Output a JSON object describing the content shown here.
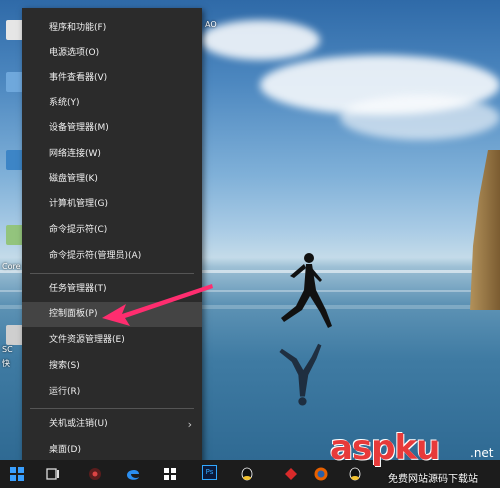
{
  "power_menu": {
    "items": [
      {
        "label": "程序和功能(F)"
      },
      {
        "label": "电源选项(O)"
      },
      {
        "label": "事件查看器(V)"
      },
      {
        "label": "系统(Y)"
      },
      {
        "label": "设备管理器(M)"
      },
      {
        "label": "网络连接(W)"
      },
      {
        "label": "磁盘管理(K)"
      },
      {
        "label": "计算机管理(G)"
      },
      {
        "label": "命令提示符(C)"
      },
      {
        "label": "命令提示符(管理员)(A)"
      },
      {
        "label": "任务管理器(T)"
      },
      {
        "label": "控制面板(P)"
      },
      {
        "label": "文件资源管理器(E)"
      },
      {
        "label": "搜索(S)"
      },
      {
        "label": "运行(R)"
      },
      {
        "label": "关机或注销(U)"
      },
      {
        "label": "桌面(D)"
      }
    ],
    "highlighted_item": "控制面板(P)"
  },
  "desktop": {
    "partial_labels": [
      "AO",
      "Core",
      "SC",
      "快"
    ]
  },
  "taskbar": {
    "items": [
      "start-icon",
      "task-view-icon",
      "app-icon",
      "edge-icon",
      "store-icon",
      "photoshop-icon",
      "qq-icon",
      "game-icon",
      "firefox-icon",
      "qq-icon-2"
    ],
    "photoshop_label": "Ps"
  },
  "watermark": {
    "brand": "aspku",
    "suffix": ".net",
    "subtitle": "免费网站源码下载站"
  },
  "colors": {
    "menu_bg": "#2b2b2b",
    "menu_highlight": "#444444",
    "annotation_arrow": "#ff2d6f",
    "taskbar_bg": "#1c1c1c",
    "watermark_red": "#e73a3a"
  }
}
